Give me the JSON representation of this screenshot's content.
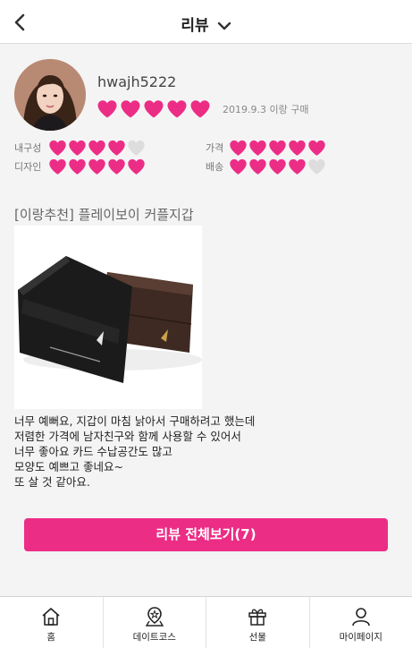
{
  "header": {
    "title": "리뷰",
    "back_icon": "chevron-left-icon",
    "dropdown_icon": "chevron-down-icon"
  },
  "review": {
    "username": "hwajh5222",
    "overall_rating": 5,
    "purchase_info": "2019.9.3 이랑 구매",
    "ratings": [
      {
        "label": "내구성",
        "value": 4
      },
      {
        "label": "가격",
        "value": 5
      },
      {
        "label": "디자인",
        "value": 5
      },
      {
        "label": "배송",
        "value": 4
      }
    ],
    "product_title": "[이랑추천] 플레이보이 커플지갑",
    "body_lines": [
      "너무 예뻐요, 지갑이 마침 낡아서 구매하려고 했는데",
      "저렴한 가격에 남자친구와 함께 사용할 수 있어서",
      "너무 좋아요 카드 수납공간도 많고",
      "모양도 예쁘고 좋네요~",
      "또 살 것 같아요."
    ]
  },
  "view_all_button": "리뷰 전체보기(7)",
  "tabbar": {
    "items": [
      {
        "label": "홈",
        "icon": "home-icon"
      },
      {
        "label": "데이트코스",
        "icon": "map-pin-icon"
      },
      {
        "label": "선물",
        "icon": "gift-icon"
      },
      {
        "label": "마이페이지",
        "icon": "user-icon"
      }
    ]
  },
  "colors": {
    "accent": "#ec2d86",
    "heart_on": "#ec2d86",
    "heart_off": "#dddddd"
  }
}
